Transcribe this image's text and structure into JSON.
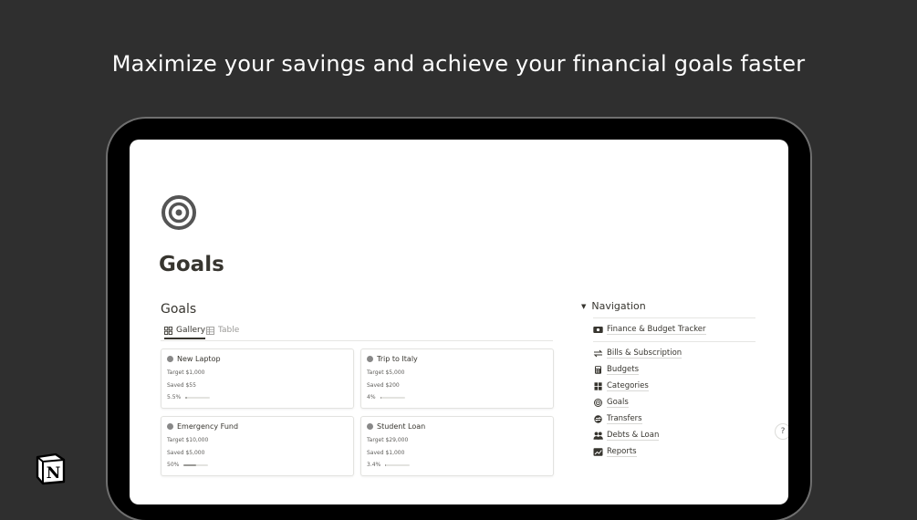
{
  "headline": "Maximize your savings and achieve your financial goals faster",
  "page": {
    "title": "Goals",
    "icon": "target-icon",
    "database_title": "Goals",
    "tabs": [
      {
        "label": "Gallery",
        "icon": "gallery-icon",
        "active": true
      },
      {
        "label": "Table",
        "icon": "table-icon",
        "active": false
      }
    ],
    "cards": [
      {
        "name": "New Laptop",
        "target": "Target $1,000",
        "saved": "Saved $55",
        "progress_label": "5.5%",
        "progress": 0.055
      },
      {
        "name": "Trip to Italy",
        "target": "Target $5,000",
        "saved": "Saved $200",
        "progress_label": "4%",
        "progress": 0.04
      },
      {
        "name": "Emergency Fund",
        "target": "Target $10,000",
        "saved": "Saved $5,000",
        "progress_label": "50%",
        "progress": 0.5
      },
      {
        "name": "Student Loan",
        "target": "Target $29,000",
        "saved": "Saved $1,000",
        "progress_label": "3.4%",
        "progress": 0.034
      }
    ]
  },
  "navigation": {
    "heading": "Navigation",
    "items": [
      {
        "label": "Finance & Budget Tracker",
        "icon": "money-icon"
      },
      {
        "label": "Bills & Subscription",
        "icon": "repeat-icon"
      },
      {
        "label": "Budgets",
        "icon": "calculator-icon"
      },
      {
        "label": "Categories",
        "icon": "grid-icon"
      },
      {
        "label": "Goals",
        "icon": "target-icon"
      },
      {
        "label": "Transfers",
        "icon": "transfer-icon"
      },
      {
        "label": "Debts & Loan",
        "icon": "people-icon"
      },
      {
        "label": "Reports",
        "icon": "chart-icon"
      }
    ]
  },
  "help_label": "?",
  "colors": {
    "background": "#2f2f2f",
    "device": "#000000",
    "screen": "#ffffff",
    "text": "#37352f"
  }
}
